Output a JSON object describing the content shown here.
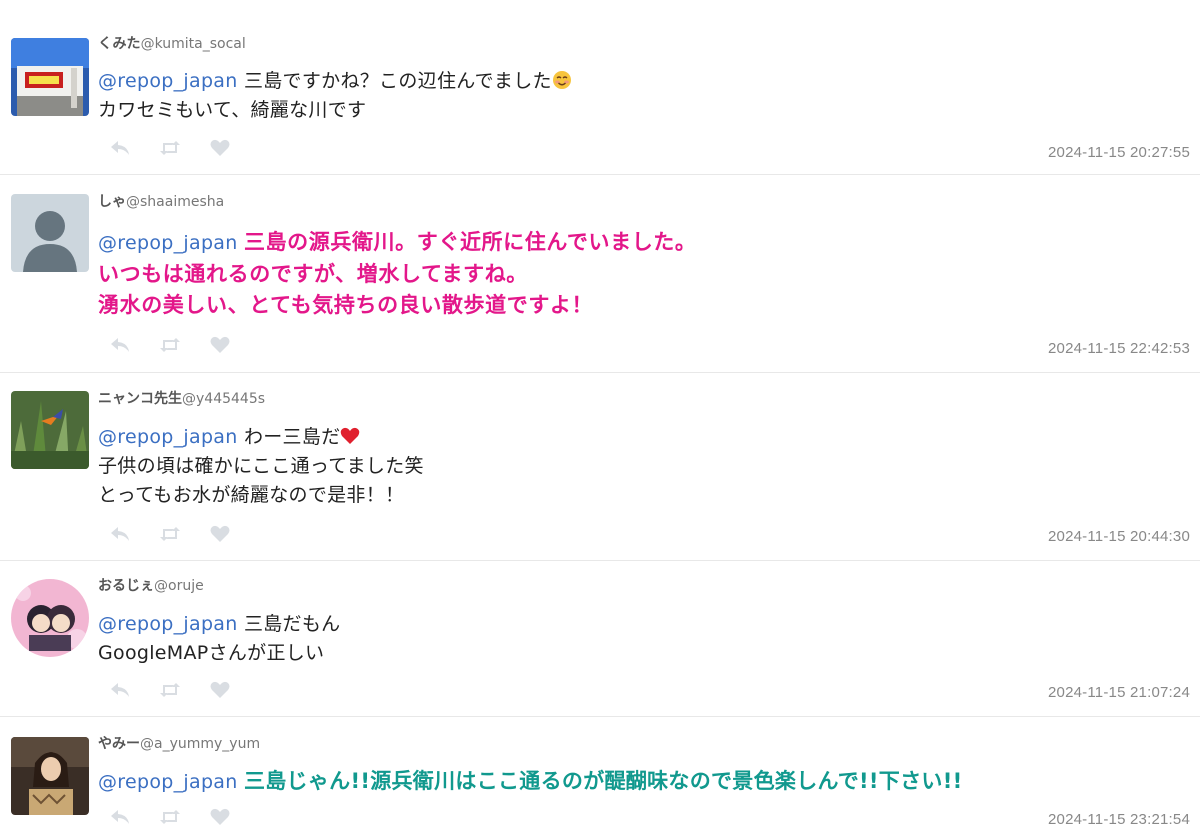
{
  "tweets": [
    {
      "name": "くみた",
      "handle": "@kumita_socal",
      "mention": "@repop_japan",
      "lines": [
        "三島ですかね？この辺住んでました",
        "カワセミもいて、綺麗な川です"
      ],
      "emoji": "smiling-blush-emoji",
      "timestamp": "2024-11-15 20:27:55"
    },
    {
      "name": "しゃ",
      "handle": "@shaaimesha",
      "mention": "@repop_japan",
      "lines": [
        "三島の源兵衛川。すぐ近所に住んでいました。",
        "いつもは通れるのですが、増水してますね。",
        "湧水の美しい、とても気持ちの良い散歩道ですよ！"
      ],
      "text_color": "#e3178a",
      "timestamp": "2024-11-15 22:42:53"
    },
    {
      "name": "ニャンコ先生",
      "handle": "@y445445s",
      "mention": "@repop_japan",
      "lines": [
        "わー三島だ",
        "子供の頃は確かにここ通ってました笑",
        "とってもお水が綺麗なので是非！！"
      ],
      "emoji": "red-heart-emoji",
      "timestamp": "2024-11-15 20:44:30"
    },
    {
      "name": "おるじぇ",
      "handle": "@oruje",
      "mention": "@repop_japan",
      "lines": [
        "三島だもん",
        "GoogleMAPさんが正しい"
      ],
      "timestamp": "2024-11-15 21:07:24"
    },
    {
      "name": "やみー",
      "handle": "@a_yummy_yum",
      "mention": "@repop_japan",
      "lines": [
        "三島じゃん!!源兵衛川はここ通るのが醍醐味なので景色楽しんで!!下さい!!"
      ],
      "text_color": "#11998e",
      "timestamp": "2024-11-15 23:21:54"
    }
  ],
  "actions": {
    "reply_icon": "reply-icon",
    "retweet_icon": "retweet-icon",
    "like_icon": "heart-icon",
    "color": "#d9dde2"
  },
  "colors": {
    "mention": "#3b6fc2",
    "pink": "#e3178a",
    "teal": "#11998e"
  }
}
